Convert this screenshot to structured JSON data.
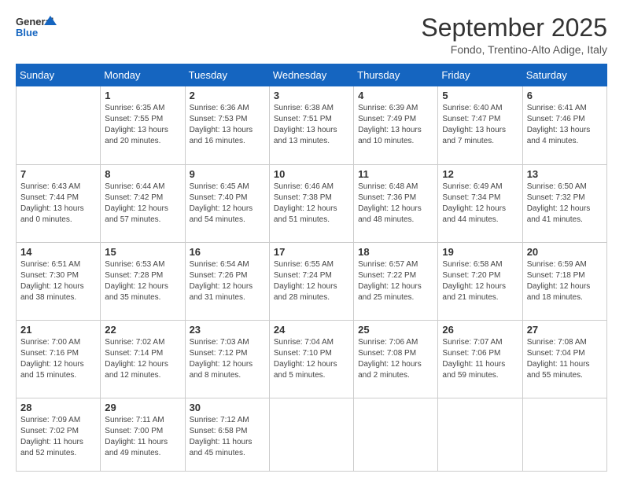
{
  "logo": {
    "line1": "General",
    "line2": "Blue"
  },
  "title": "September 2025",
  "subtitle": "Fondo, Trentino-Alto Adige, Italy",
  "days_header": [
    "Sunday",
    "Monday",
    "Tuesday",
    "Wednesday",
    "Thursday",
    "Friday",
    "Saturday"
  ],
  "weeks": [
    [
      {
        "num": "",
        "info": ""
      },
      {
        "num": "1",
        "info": "Sunrise: 6:35 AM\nSunset: 7:55 PM\nDaylight: 13 hours\nand 20 minutes."
      },
      {
        "num": "2",
        "info": "Sunrise: 6:36 AM\nSunset: 7:53 PM\nDaylight: 13 hours\nand 16 minutes."
      },
      {
        "num": "3",
        "info": "Sunrise: 6:38 AM\nSunset: 7:51 PM\nDaylight: 13 hours\nand 13 minutes."
      },
      {
        "num": "4",
        "info": "Sunrise: 6:39 AM\nSunset: 7:49 PM\nDaylight: 13 hours\nand 10 minutes."
      },
      {
        "num": "5",
        "info": "Sunrise: 6:40 AM\nSunset: 7:47 PM\nDaylight: 13 hours\nand 7 minutes."
      },
      {
        "num": "6",
        "info": "Sunrise: 6:41 AM\nSunset: 7:46 PM\nDaylight: 13 hours\nand 4 minutes."
      }
    ],
    [
      {
        "num": "7",
        "info": "Sunrise: 6:43 AM\nSunset: 7:44 PM\nDaylight: 13 hours\nand 0 minutes."
      },
      {
        "num": "8",
        "info": "Sunrise: 6:44 AM\nSunset: 7:42 PM\nDaylight: 12 hours\nand 57 minutes."
      },
      {
        "num": "9",
        "info": "Sunrise: 6:45 AM\nSunset: 7:40 PM\nDaylight: 12 hours\nand 54 minutes."
      },
      {
        "num": "10",
        "info": "Sunrise: 6:46 AM\nSunset: 7:38 PM\nDaylight: 12 hours\nand 51 minutes."
      },
      {
        "num": "11",
        "info": "Sunrise: 6:48 AM\nSunset: 7:36 PM\nDaylight: 12 hours\nand 48 minutes."
      },
      {
        "num": "12",
        "info": "Sunrise: 6:49 AM\nSunset: 7:34 PM\nDaylight: 12 hours\nand 44 minutes."
      },
      {
        "num": "13",
        "info": "Sunrise: 6:50 AM\nSunset: 7:32 PM\nDaylight: 12 hours\nand 41 minutes."
      }
    ],
    [
      {
        "num": "14",
        "info": "Sunrise: 6:51 AM\nSunset: 7:30 PM\nDaylight: 12 hours\nand 38 minutes."
      },
      {
        "num": "15",
        "info": "Sunrise: 6:53 AM\nSunset: 7:28 PM\nDaylight: 12 hours\nand 35 minutes."
      },
      {
        "num": "16",
        "info": "Sunrise: 6:54 AM\nSunset: 7:26 PM\nDaylight: 12 hours\nand 31 minutes."
      },
      {
        "num": "17",
        "info": "Sunrise: 6:55 AM\nSunset: 7:24 PM\nDaylight: 12 hours\nand 28 minutes."
      },
      {
        "num": "18",
        "info": "Sunrise: 6:57 AM\nSunset: 7:22 PM\nDaylight: 12 hours\nand 25 minutes."
      },
      {
        "num": "19",
        "info": "Sunrise: 6:58 AM\nSunset: 7:20 PM\nDaylight: 12 hours\nand 21 minutes."
      },
      {
        "num": "20",
        "info": "Sunrise: 6:59 AM\nSunset: 7:18 PM\nDaylight: 12 hours\nand 18 minutes."
      }
    ],
    [
      {
        "num": "21",
        "info": "Sunrise: 7:00 AM\nSunset: 7:16 PM\nDaylight: 12 hours\nand 15 minutes."
      },
      {
        "num": "22",
        "info": "Sunrise: 7:02 AM\nSunset: 7:14 PM\nDaylight: 12 hours\nand 12 minutes."
      },
      {
        "num": "23",
        "info": "Sunrise: 7:03 AM\nSunset: 7:12 PM\nDaylight: 12 hours\nand 8 minutes."
      },
      {
        "num": "24",
        "info": "Sunrise: 7:04 AM\nSunset: 7:10 PM\nDaylight: 12 hours\nand 5 minutes."
      },
      {
        "num": "25",
        "info": "Sunrise: 7:06 AM\nSunset: 7:08 PM\nDaylight: 12 hours\nand 2 minutes."
      },
      {
        "num": "26",
        "info": "Sunrise: 7:07 AM\nSunset: 7:06 PM\nDaylight: 11 hours\nand 59 minutes."
      },
      {
        "num": "27",
        "info": "Sunrise: 7:08 AM\nSunset: 7:04 PM\nDaylight: 11 hours\nand 55 minutes."
      }
    ],
    [
      {
        "num": "28",
        "info": "Sunrise: 7:09 AM\nSunset: 7:02 PM\nDaylight: 11 hours\nand 52 minutes."
      },
      {
        "num": "29",
        "info": "Sunrise: 7:11 AM\nSunset: 7:00 PM\nDaylight: 11 hours\nand 49 minutes."
      },
      {
        "num": "30",
        "info": "Sunrise: 7:12 AM\nSunset: 6:58 PM\nDaylight: 11 hours\nand 45 minutes."
      },
      {
        "num": "",
        "info": ""
      },
      {
        "num": "",
        "info": ""
      },
      {
        "num": "",
        "info": ""
      },
      {
        "num": "",
        "info": ""
      }
    ]
  ]
}
